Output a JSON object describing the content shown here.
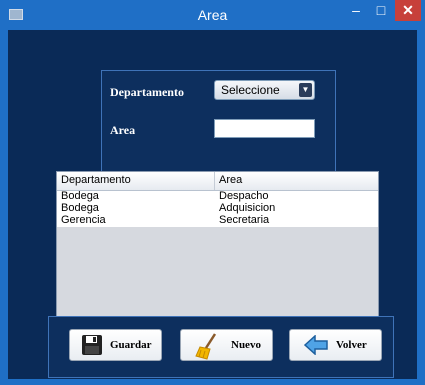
{
  "window": {
    "title": "Area",
    "min_label": "–",
    "max_label": "□",
    "close_label": "✕"
  },
  "form": {
    "departamento_label": "Departamento",
    "departamento_value": "Seleccione",
    "area_label": "Area",
    "area_value": ""
  },
  "table": {
    "columns": [
      "Departamento",
      "Area"
    ],
    "rows": [
      [
        "Bodega",
        "Despacho"
      ],
      [
        "Bodega",
        "Adquisicion"
      ],
      [
        "Gerencia",
        "Secretaria"
      ]
    ]
  },
  "buttons": {
    "guardar": "Guardar",
    "nuevo": "Nuevo",
    "volver": "Volver"
  },
  "icons": {
    "guardar": "floppy-disk-icon",
    "nuevo": "broom-icon",
    "volver": "back-arrow-icon"
  },
  "colors": {
    "title_bar": "#1f6fc6",
    "content_bg": "#0a2a57",
    "close": "#c7403a"
  }
}
